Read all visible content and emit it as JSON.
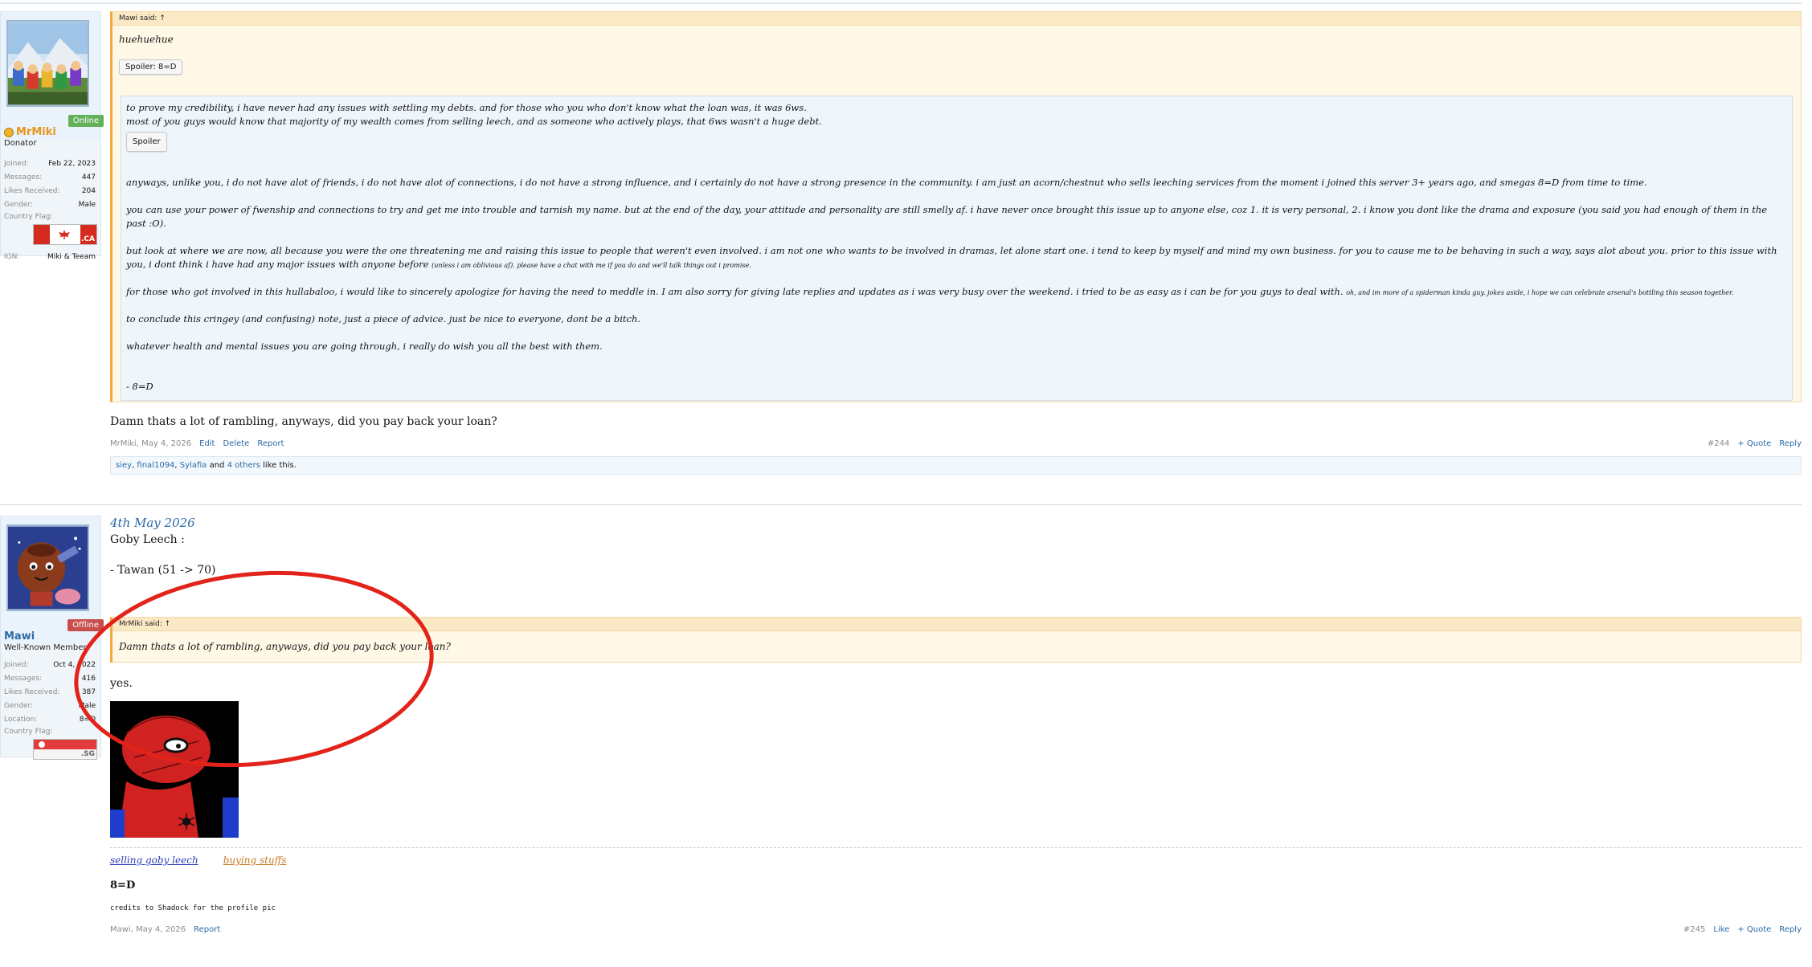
{
  "colors": {
    "accent": "#2c6aa6",
    "quote_border": "#f3a93d",
    "online": "#63b15a",
    "offline": "#c84d4d",
    "annotation": "#e2231a"
  },
  "post1": {
    "user": {
      "name": "MrMiki",
      "title": "Donator",
      "status": "Online",
      "icon": "donator-coin-icon",
      "stats": [
        {
          "k": "Joined:",
          "v": "Feb 22, 2023"
        },
        {
          "k": "Messages:",
          "v": "447"
        },
        {
          "k": "Likes Received:",
          "v": "204"
        },
        {
          "k": "Gender:",
          "v": "Male"
        },
        {
          "k": "Country Flag:",
          "v": ""
        }
      ],
      "flag_code": ".CA",
      "ign_k": "IGN:",
      "ign_v": "Miki & Teeam"
    },
    "quote": {
      "head": "Mawi said: ↑",
      "line1": "huehuehue",
      "spoiler_btn": "Spoiler: 8=D",
      "p1a": "to prove my credibility, i have never had any issues with settling my debts. and for those who you who don't know what the loan was, it was 6ws.",
      "p1b": "most of you guys would know that majority of my wealth comes from selling leech, and as someone who actively plays, that 6ws wasn't a huge debt.",
      "spoiler2": "Spoiler",
      "p2": "anyways, unlike you, i do not have alot of friends, i do not have alot of connections, i do not have a strong influence, and i certainly do not have a strong presence in the community. i am just an acorn/chestnut who sells leeching services from the moment i joined this server 3+ years ago, and smegas 8=D from time to time.",
      "p3": "you can use your power of fwenship and connections to try and get me into trouble and tarnish my name. but at the end of the day, your attitude and personality are still smelly af. i have never once brought this issue up to anyone else, coz 1. it is very personal, 2. i know you dont like the drama and exposure (you said you had enough of them in the past :O).",
      "p4": "but look at where we are now, all because you were the one threatening me and raising this issue to people that weren't even involved. i am not one who wants to be involved in dramas, let alone start one. i tend to keep by myself and mind my own business. for you to cause me to be behaving in such a way, says alot about you. prior to this issue with you, i dont think i have had any major issues with anyone before",
      "p4small": "(unless i am oblivious af). please have a chat with me if you do and we'll talk things out i promise.",
      "p5": "for those who got involved in this hullabaloo, i would like to sincerely apologize for having the need to meddle in. I am also sorry for giving late replies and updates as i was very busy over the weekend. i tried to be as easy as i can be for you guys to deal with.",
      "p5small": "oh, and im more of a spiderman kinda guy. jokes aside, i hope we can celebrate arsenal's bottling this season together.",
      "p6": "to conclude this cringey (and confusing) note, just a piece of advice. just be nice to everyone, dont be a bitch.",
      "p7": "whatever health and mental issues you are going through, i really do wish you all the best with them.",
      "p8": "- 8=D"
    },
    "body": "Damn thats a lot of rambling, anyways, did you pay back your loan?",
    "footer": {
      "meta": "MrMiki, May 4, 2026",
      "edit": "Edit",
      "delete": "Delete",
      "report": "Report",
      "num": "#244",
      "quote": "+ Quote",
      "reply": "Reply"
    },
    "likes": {
      "l1": "siey",
      "sep1": ", ",
      "l2": "final1094",
      "sep2": ", ",
      "l3": "Sylafia",
      "and": " and ",
      "l4": "4 others",
      "tail": " like this."
    }
  },
  "post2": {
    "user": {
      "name": "Mawi",
      "title": "Well-Known Member",
      "status": "Offline",
      "stats": [
        {
          "k": "Joined:",
          "v": "Oct 4, 2022"
        },
        {
          "k": "Messages:",
          "v": "416"
        },
        {
          "k": "Likes Received:",
          "v": "387"
        },
        {
          "k": "Gender:",
          "v": "Male"
        },
        {
          "k": "Location:",
          "v": "8=D"
        },
        {
          "k": "Country Flag:",
          "v": ""
        }
      ],
      "flag_code": ".SG"
    },
    "date": "4th May 2026",
    "line1": "Goby Leech :",
    "line2": "- Tawan (51 -> 70)",
    "quote": {
      "head": "MrMiki said: ↑",
      "text": "Damn thats a lot of rambling, anyways, did you pay back your loan?"
    },
    "reply": "yes.",
    "sig": {
      "link1": "selling goby leech",
      "link2": "buying stuffs",
      "bold": "8=D",
      "credit": "credits to Shadock for the profile pic"
    },
    "footer": {
      "meta": "Mawi, May 4, 2026",
      "report": "Report",
      "num": "#245",
      "like": "Like",
      "quote": "+ Quote",
      "reply": "Reply"
    }
  }
}
